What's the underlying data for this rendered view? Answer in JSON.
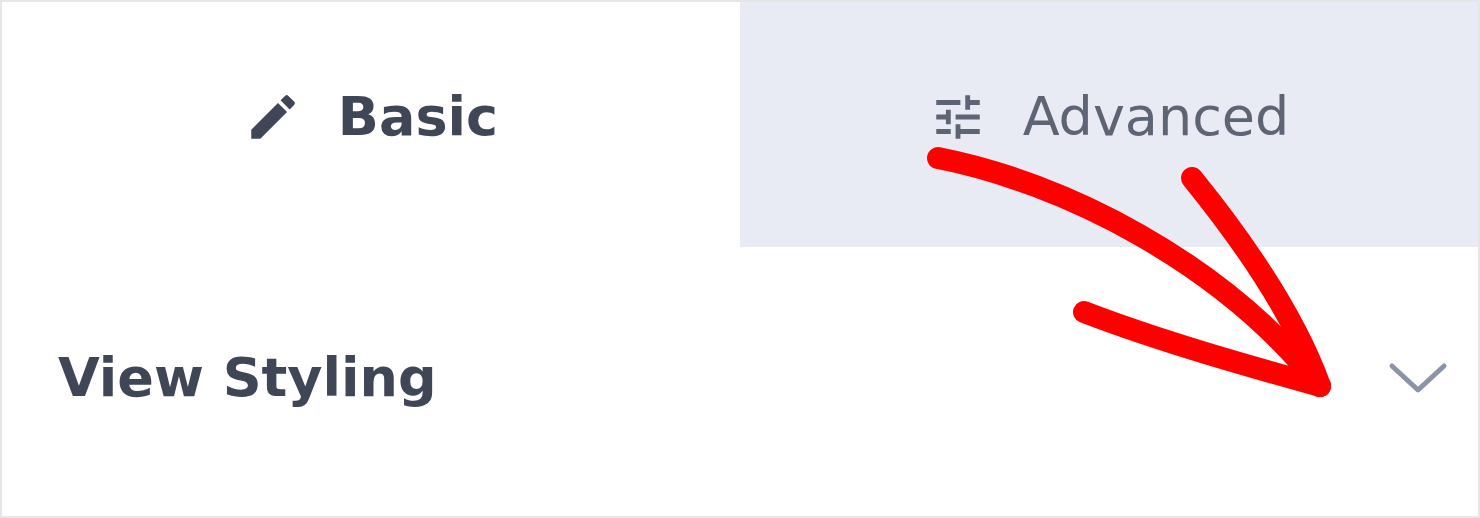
{
  "tabs": [
    {
      "label": "Basic",
      "selected": true
    },
    {
      "label": "Advanced",
      "selected": false
    }
  ],
  "section": {
    "title": "View Styling",
    "expanded": false
  }
}
